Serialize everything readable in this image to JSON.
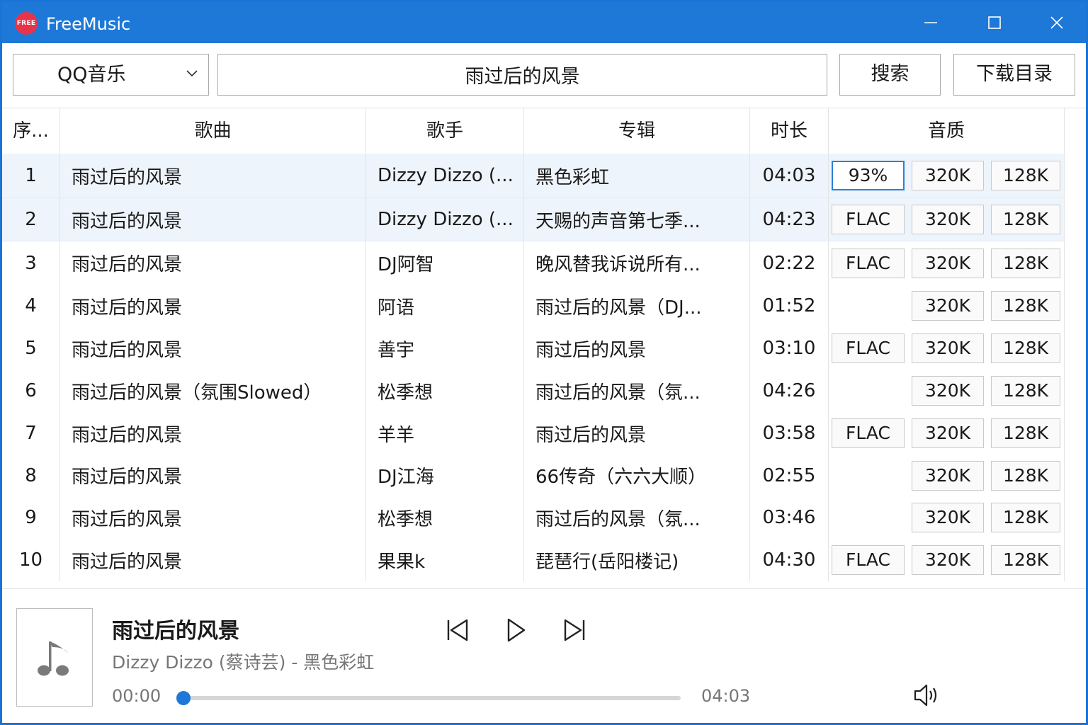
{
  "app": {
    "title": "FreeMusic",
    "logo_text": "FREE"
  },
  "toolbar": {
    "source": "QQ音乐",
    "search_value": "雨过后的风景",
    "search_label": "搜索",
    "download_dir_label": "下载目录"
  },
  "table": {
    "headers": {
      "index": "序...",
      "song": "歌曲",
      "artist": "歌手",
      "album": "专辑",
      "duration": "时长",
      "quality": "音质"
    },
    "rows": [
      {
        "index": "1",
        "song": "雨过后的风景",
        "artist": "Dizzy Dizzo (...",
        "album": "黑色彩虹",
        "duration": "04:03",
        "q1": "93%",
        "q2": "320K",
        "q3": "128K"
      },
      {
        "index": "2",
        "song": "雨过后的风景",
        "artist": "Dizzy Dizzo (...",
        "album": "天赐的声音第七季...",
        "duration": "04:23",
        "q1": "FLAC",
        "q2": "320K",
        "q3": "128K"
      },
      {
        "index": "3",
        "song": "雨过后的风景",
        "artist": "DJ阿智",
        "album": "晚风替我诉说所有...",
        "duration": "02:22",
        "q1": "FLAC",
        "q2": "320K",
        "q3": "128K"
      },
      {
        "index": "4",
        "song": "雨过后的风景",
        "artist": "阿语",
        "album": "雨过后的风景（DJ...",
        "duration": "01:52",
        "q1": "",
        "q2": "320K",
        "q3": "128K"
      },
      {
        "index": "5",
        "song": "雨过后的风景",
        "artist": "善宇",
        "album": "雨过后的风景",
        "duration": "03:10",
        "q1": "FLAC",
        "q2": "320K",
        "q3": "128K"
      },
      {
        "index": "6",
        "song": "雨过后的风景（氛围Slowed）",
        "artist": "松季想",
        "album": "雨过后的风景（氛...",
        "duration": "04:26",
        "q1": "",
        "q2": "320K",
        "q3": "128K"
      },
      {
        "index": "7",
        "song": "雨过后的风景",
        "artist": "羊羊",
        "album": "雨过后的风景",
        "duration": "03:58",
        "q1": "FLAC",
        "q2": "320K",
        "q3": "128K"
      },
      {
        "index": "8",
        "song": "雨过后的风景",
        "artist": "DJ江海",
        "album": "66传奇（六六大顺）",
        "duration": "02:55",
        "q1": "",
        "q2": "320K",
        "q3": "128K"
      },
      {
        "index": "9",
        "song": "雨过后的风景",
        "artist": "松季想",
        "album": "雨过后的风景（氛...",
        "duration": "03:46",
        "q1": "",
        "q2": "320K",
        "q3": "128K"
      },
      {
        "index": "10",
        "song": "雨过后的风景",
        "artist": "果果k",
        "album": "琵琶行(岳阳楼记)",
        "duration": "04:30",
        "q1": "FLAC",
        "q2": "320K",
        "q3": "128K"
      }
    ]
  },
  "player": {
    "title": "雨过后的风景",
    "subtitle": "Dizzy Dizzo (蔡诗芸) - 黑色彩虹",
    "current_time": "00:00",
    "total_time": "04:03",
    "progress": 0.0
  },
  "colors": {
    "accent": "#1e78d7",
    "logo": "#e8344a",
    "selected_row": "#eef4fb"
  },
  "icons": {
    "window": [
      "minimize-icon",
      "maximize-icon",
      "close-icon"
    ],
    "player": [
      "music-note-icon",
      "previous-icon",
      "play-icon",
      "next-icon",
      "volume-icon"
    ],
    "toolbar": [
      "chevron-down-icon"
    ]
  }
}
